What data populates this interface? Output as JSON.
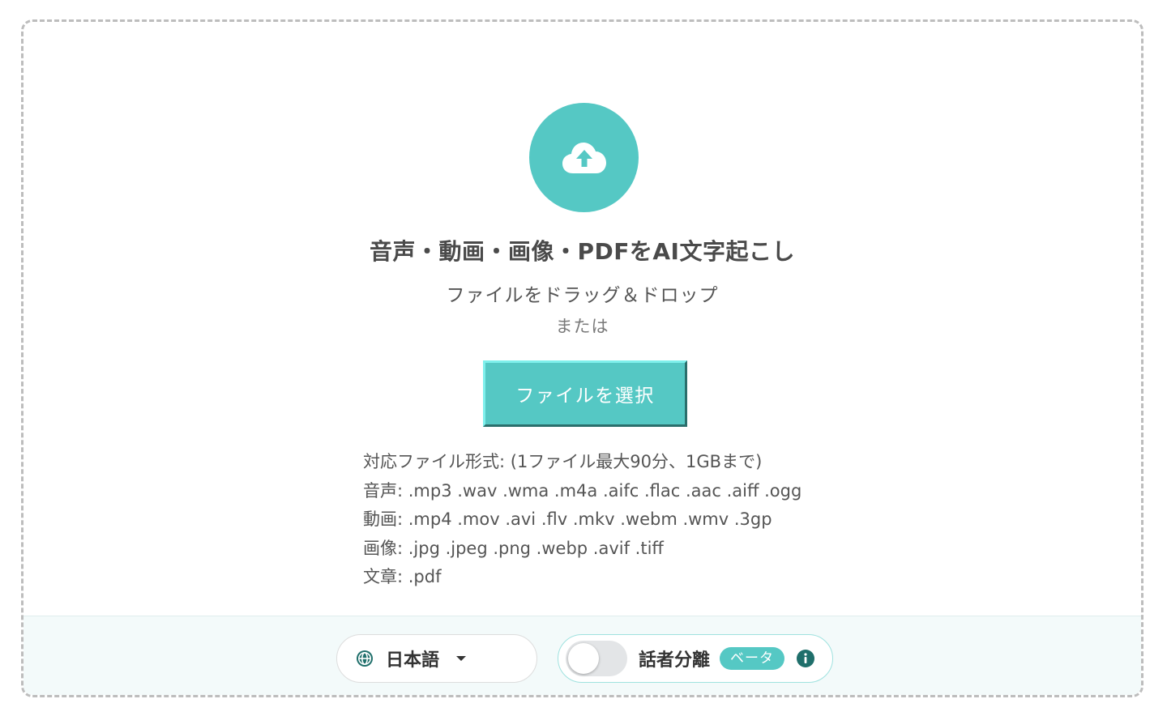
{
  "upload": {
    "title": "音声・動画・画像・PDFをAI文字起こし",
    "drag_text": "ファイルをドラッグ＆ドロップ",
    "or_text": "または",
    "select_button_label": "ファイルを選択"
  },
  "formats": {
    "heading": "対応ファイル形式: (1ファイル最大90分、1GBまで)",
    "audio": "音声: .mp3 .wav .wma .m4a .aifc .flac .aac .aiff .ogg",
    "video": "動画: .mp4 .mov .avi .flv .mkv .webm .wmv .3gp",
    "image": "画像: .jpg .jpeg .png .webp .avif .tiff",
    "document": "文章: .pdf"
  },
  "settings": {
    "language": "日本語",
    "diarization_label": "話者分離",
    "diarization_enabled": false,
    "beta_badge": "ベータ"
  },
  "colors": {
    "accent": "#55c8c4",
    "dark_accent": "#1f6f6b",
    "bottom_bg": "#f3fafa"
  },
  "icons": {
    "upload": "cloud-upload-icon",
    "language": "globe-icon",
    "dropdown": "caret-down-icon",
    "info": "info-icon"
  }
}
